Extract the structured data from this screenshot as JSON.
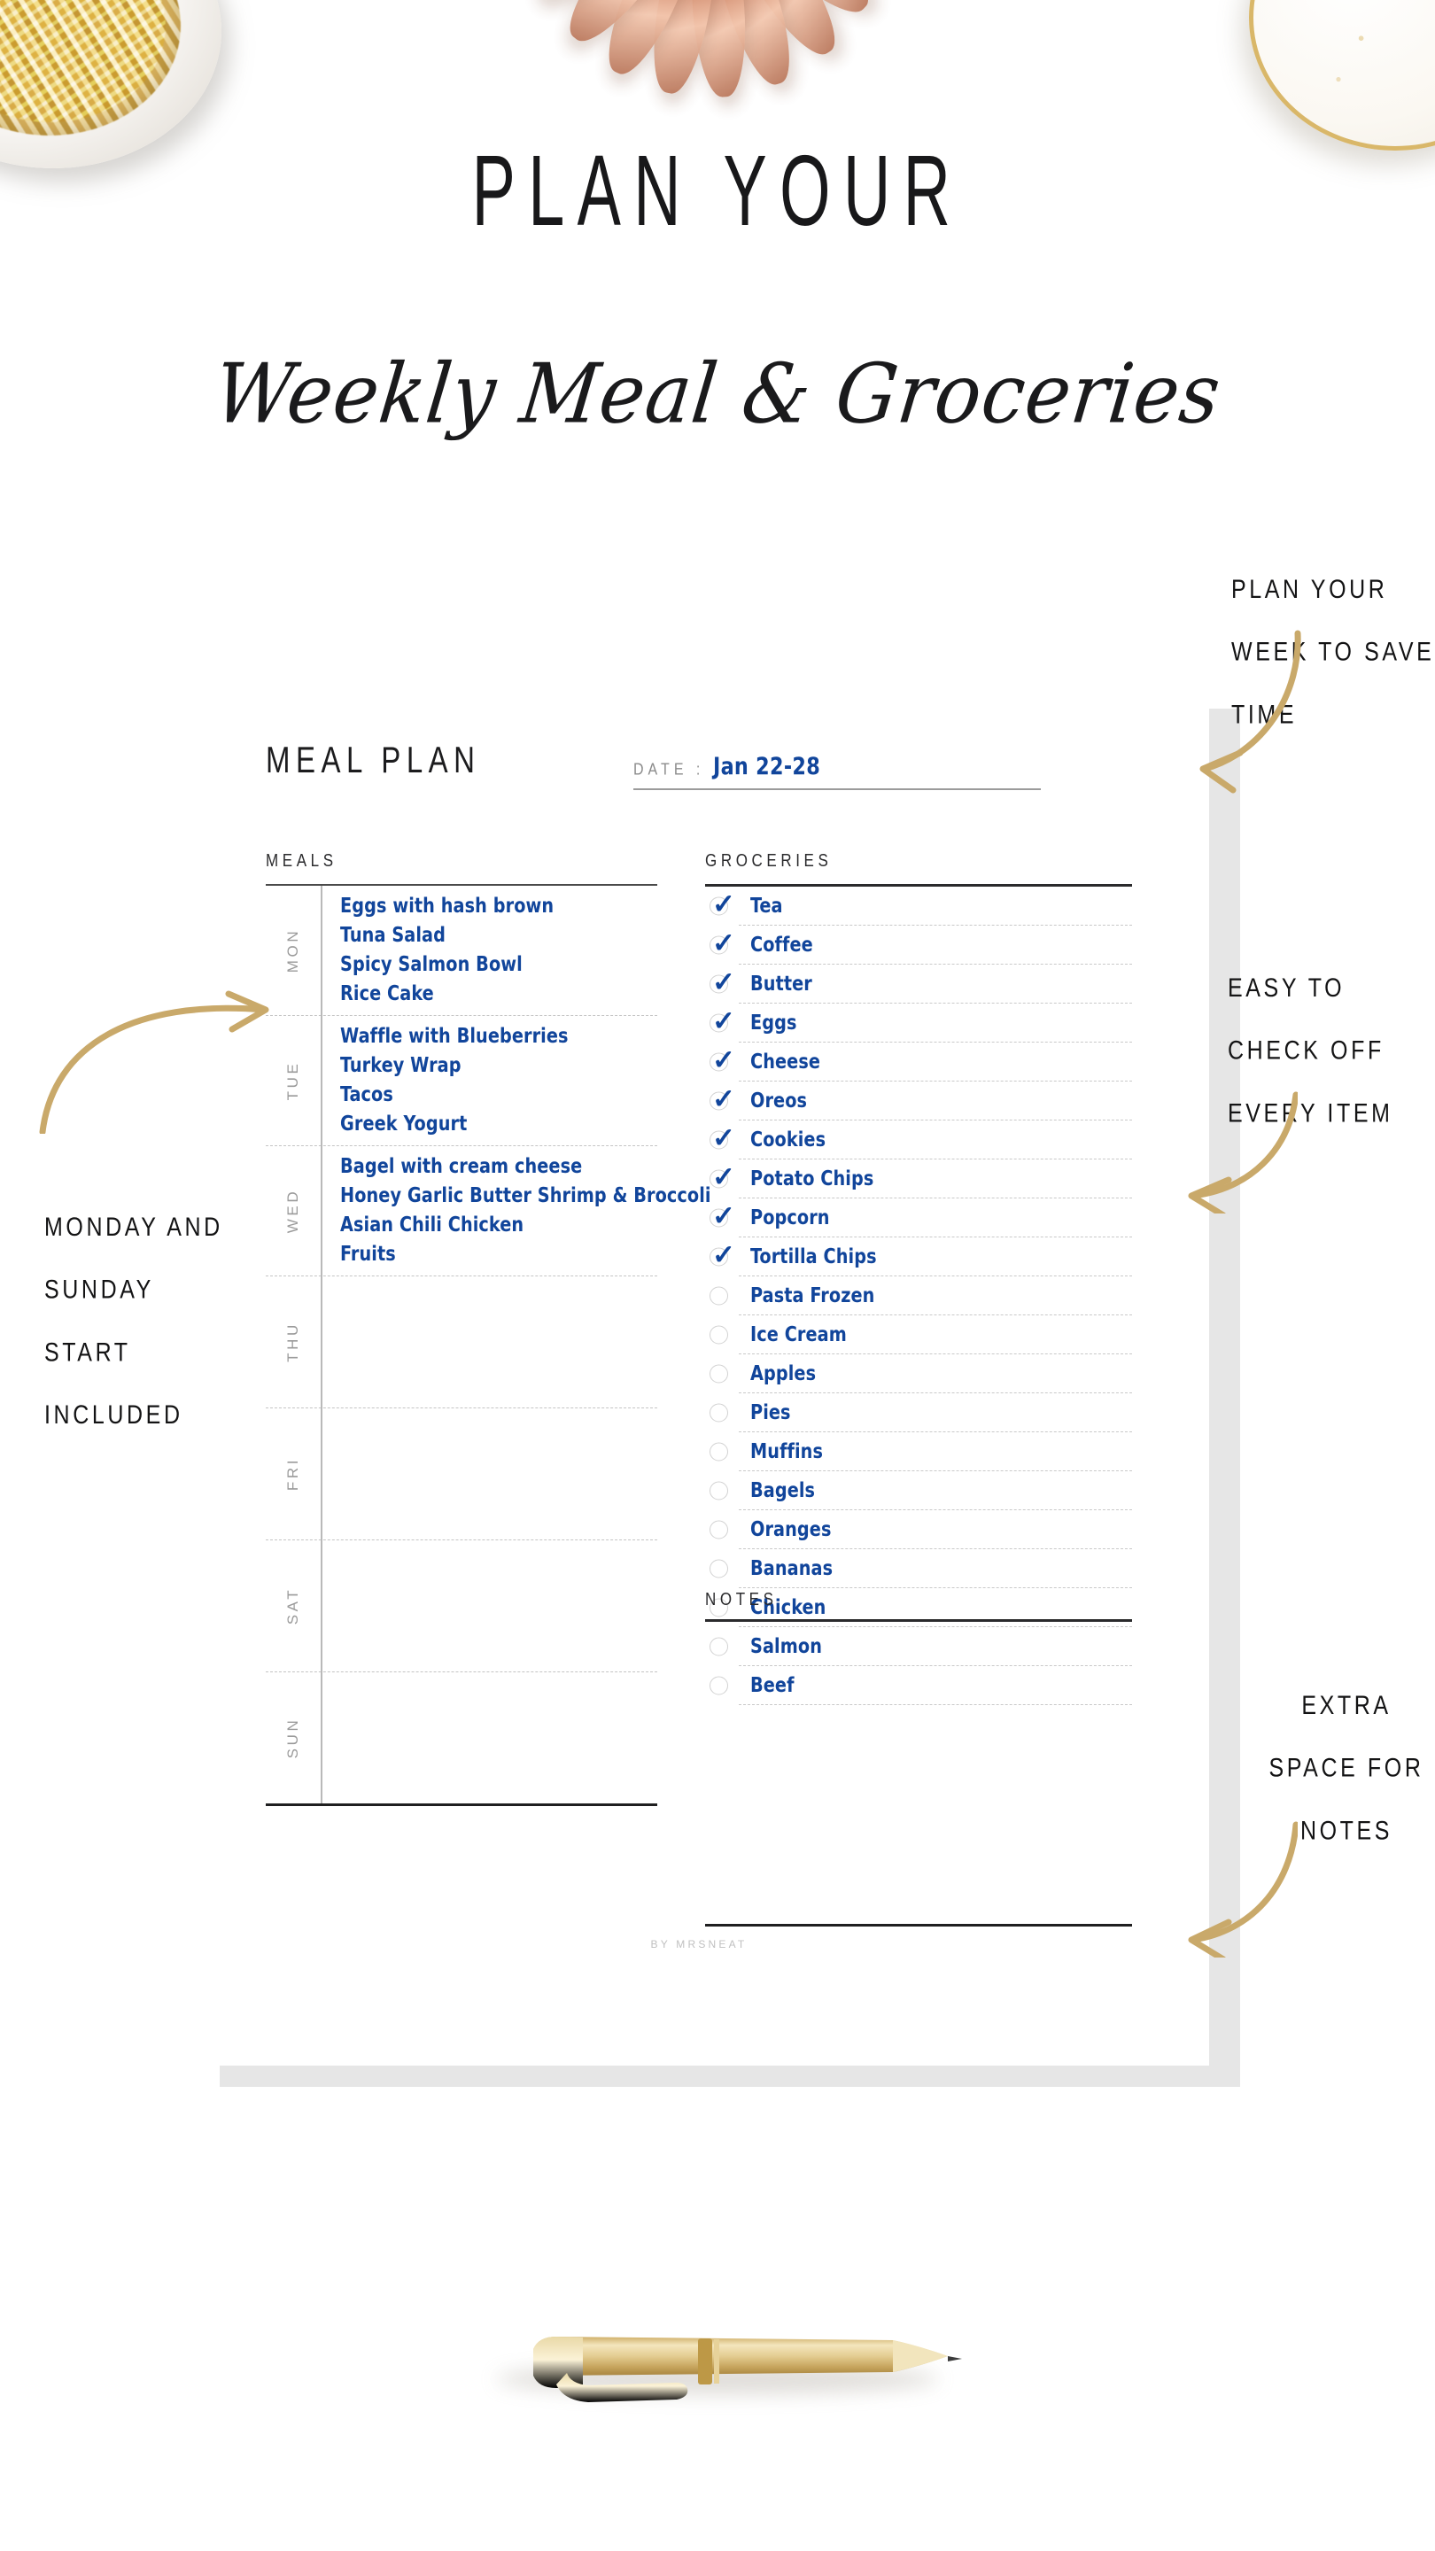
{
  "header": {
    "title_line1": "PLAN YOUR",
    "title_line2": "Weekly Meal & Groceries"
  },
  "sheet": {
    "meal_plan_heading": "MEAL PLAN",
    "date_label": "DATE :",
    "date_value": "Jan 22-28",
    "meals_label": "MEALS",
    "groceries_label": "GROCERIES",
    "notes_label": "NOTES",
    "credit": "BY MRSNEAT"
  },
  "meal_plan": {
    "days": [
      {
        "day": "MON",
        "items": [
          "Eggs with hash brown",
          "Tuna Salad",
          "Spicy Salmon Bowl",
          "Rice Cake"
        ]
      },
      {
        "day": "TUE",
        "items": [
          "Waffle with Blueberries",
          "Turkey Wrap",
          "Tacos",
          "Greek Yogurt"
        ]
      },
      {
        "day": "WED",
        "items": [
          "Bagel with cream cheese",
          "Honey Garlic Butter Shrimp & Broccoli",
          "Asian Chili Chicken",
          "Fruits"
        ]
      },
      {
        "day": "THU",
        "items": []
      },
      {
        "day": "FRI",
        "items": []
      },
      {
        "day": "SAT",
        "items": []
      },
      {
        "day": "SUN",
        "items": []
      }
    ]
  },
  "groceries": {
    "items": [
      {
        "name": "Tea",
        "checked": true
      },
      {
        "name": "Coffee",
        "checked": true
      },
      {
        "name": "Butter",
        "checked": true
      },
      {
        "name": "Eggs",
        "checked": true
      },
      {
        "name": "Cheese",
        "checked": true
      },
      {
        "name": "Oreos",
        "checked": true
      },
      {
        "name": "Cookies",
        "checked": true
      },
      {
        "name": "Potato Chips",
        "checked": true
      },
      {
        "name": "Popcorn",
        "checked": true
      },
      {
        "name": "Tortilla Chips",
        "checked": true
      },
      {
        "name": "Pasta Frozen",
        "checked": false
      },
      {
        "name": "Ice Cream",
        "checked": false
      },
      {
        "name": "Apples",
        "checked": false
      },
      {
        "name": "Pies",
        "checked": false
      },
      {
        "name": "Muffins",
        "checked": false
      },
      {
        "name": "Bagels",
        "checked": false
      },
      {
        "name": "Oranges",
        "checked": false
      },
      {
        "name": "Bananas",
        "checked": false
      },
      {
        "name": "Chicken",
        "checked": false
      },
      {
        "name": "Salmon",
        "checked": false
      },
      {
        "name": "Beef",
        "checked": false
      }
    ],
    "check_glyph": "✓"
  },
  "annotations": {
    "plan_week": "PLAN YOUR WEEK TO SAVE TIME",
    "easy_check": "EASY TO CHECK OFF EVERY ITEM",
    "extra_space": "EXTRA SPACE FOR NOTES",
    "monday_sunday": "MONDAY AND SUNDAY START INCLUDED"
  },
  "colors": {
    "accent_blue": "#11459b",
    "ink": "#1c1c1e",
    "muted": "#9a9a9a",
    "gold": "#c9a96a",
    "sheet_shadow": "#e6e6e6"
  },
  "props": {
    "top_left": "gold-binder-clips-in-bowl",
    "top_center": "rose-gold-monstera-leaf",
    "top_right": "gold-speckled-plate-with-clip",
    "bottom": "gold-ballpoint-pen"
  }
}
